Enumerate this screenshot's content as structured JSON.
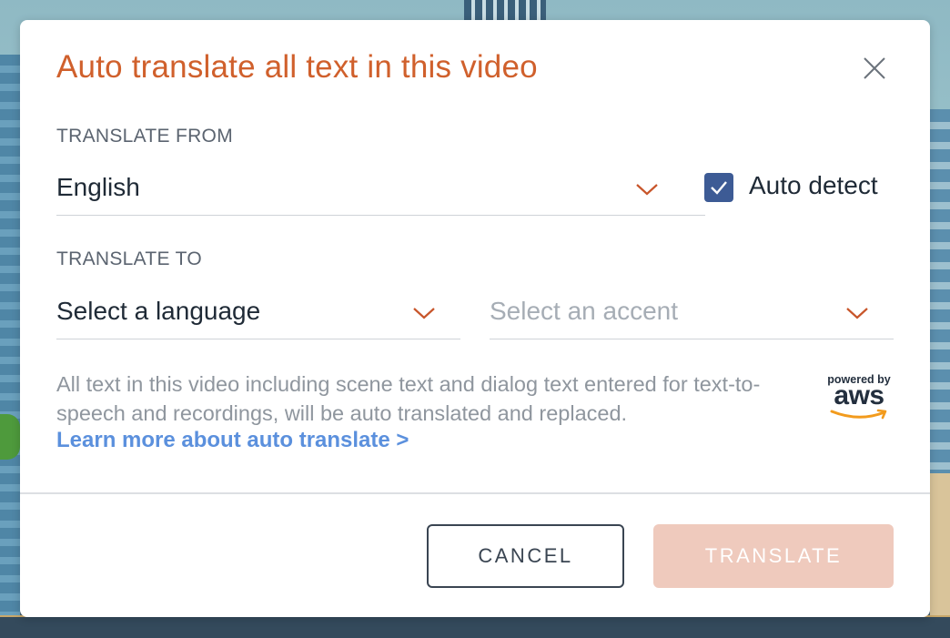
{
  "dialog": {
    "title": "Auto translate all text in this video",
    "close_icon": "close-icon"
  },
  "translate_from": {
    "label": "TRANSLATE FROM",
    "selected_language": "English",
    "auto_detect": {
      "label": "Auto detect",
      "checked": true
    }
  },
  "translate_to": {
    "label": "TRANSLATE TO",
    "language_placeholder": "Select a language",
    "accent_placeholder": "Select an accent"
  },
  "info": {
    "text": "All text in this video including scene text and dialog text entered for text-to-speech and recordings, will be auto translated and replaced.",
    "link_text": "Learn more about auto translate >"
  },
  "aws_badge": {
    "powered_by": "powered by",
    "brand": "aws"
  },
  "footer": {
    "cancel_label": "CANCEL",
    "translate_label": "TRANSLATE",
    "translate_enabled": false
  },
  "colors": {
    "title": "#d0602c",
    "accent_chevron": "#c8552a",
    "checkbox": "#3d5b95",
    "link": "#5b90dd",
    "translate_disabled_bg": "#efcabd"
  }
}
